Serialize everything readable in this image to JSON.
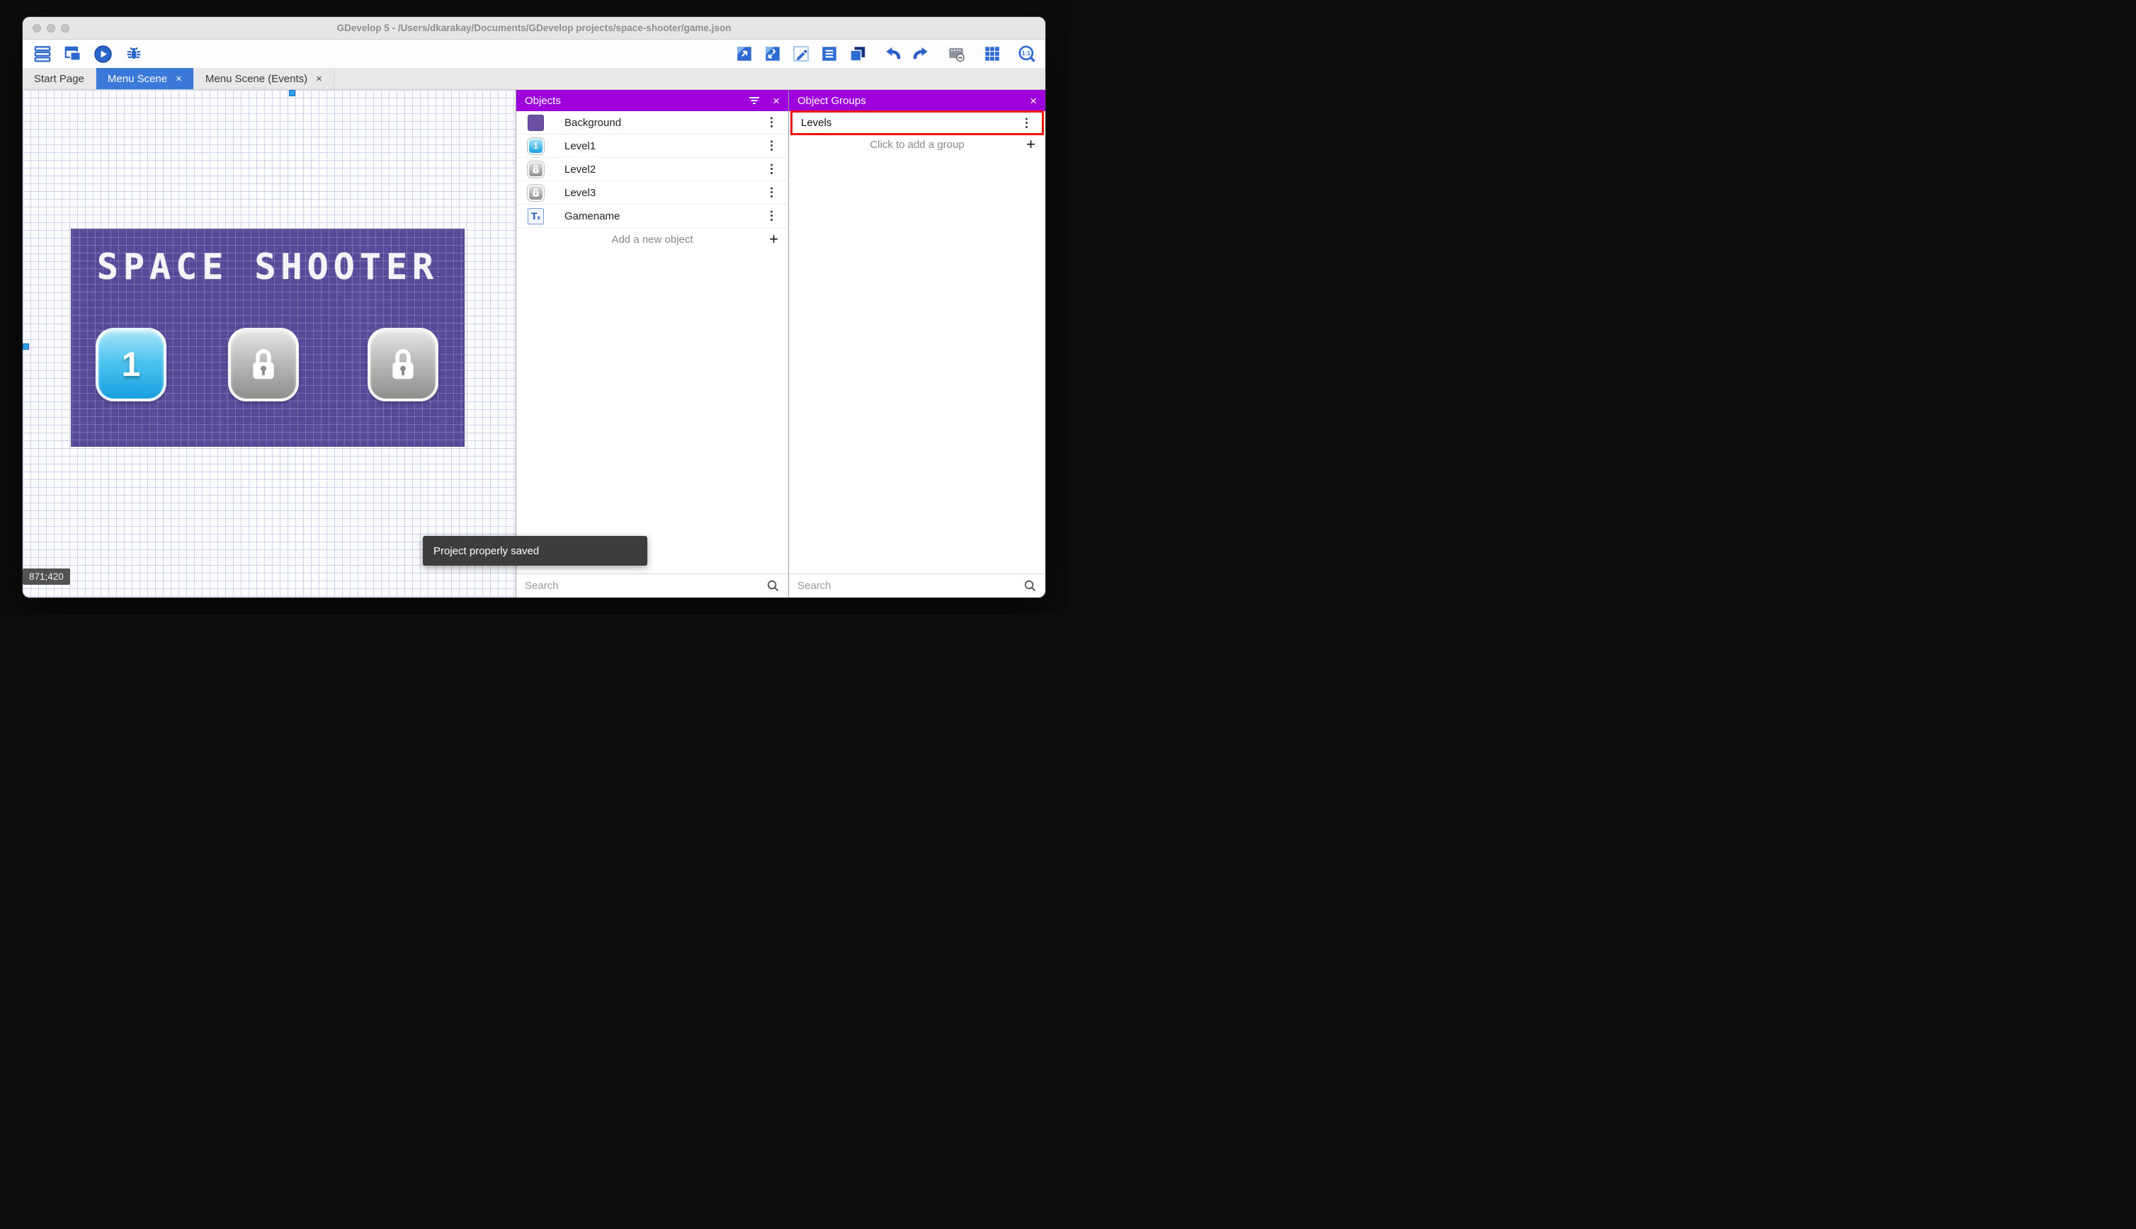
{
  "titlebar": {
    "title": "GDevelop 5 - /Users/dkarakay/Documents/GDevelop projects/space-shooter/game.json"
  },
  "toolbar": {
    "zoom_label": "1:1"
  },
  "tabs": {
    "start_page": "Start Page",
    "menu_scene": "Menu Scene",
    "menu_scene_events": "Menu Scene (Events)"
  },
  "canvas": {
    "coordinate_readout": "871;420",
    "scene_title": "SPACE SHOOTER",
    "level1_button_label": "1"
  },
  "objects_panel": {
    "title": "Objects",
    "items": [
      {
        "name": "Background"
      },
      {
        "name": "Level1"
      },
      {
        "name": "Level2"
      },
      {
        "name": "Level3"
      },
      {
        "name": "Gamename"
      }
    ],
    "add_label": "Add a new object",
    "search_placeholder": "Search"
  },
  "object_groups_panel": {
    "title": "Object Groups",
    "groups": [
      {
        "name": "Levels"
      }
    ],
    "add_label": "Click to add a group",
    "search_placeholder": "Search"
  },
  "toast": {
    "message": "Project properly saved"
  },
  "glyphs": {
    "close": "×",
    "plus": "+",
    "kebab": "⋮",
    "text_icon_main": "T",
    "text_icon_sub": "x"
  },
  "colors": {
    "panel_header_purple": "#9e00dc",
    "active_tab_blue": "#3a78da",
    "toolbar_icon_blue": "#2e6bd2",
    "annotation_red": "#ee1509",
    "scene_purple": "#584a99"
  }
}
